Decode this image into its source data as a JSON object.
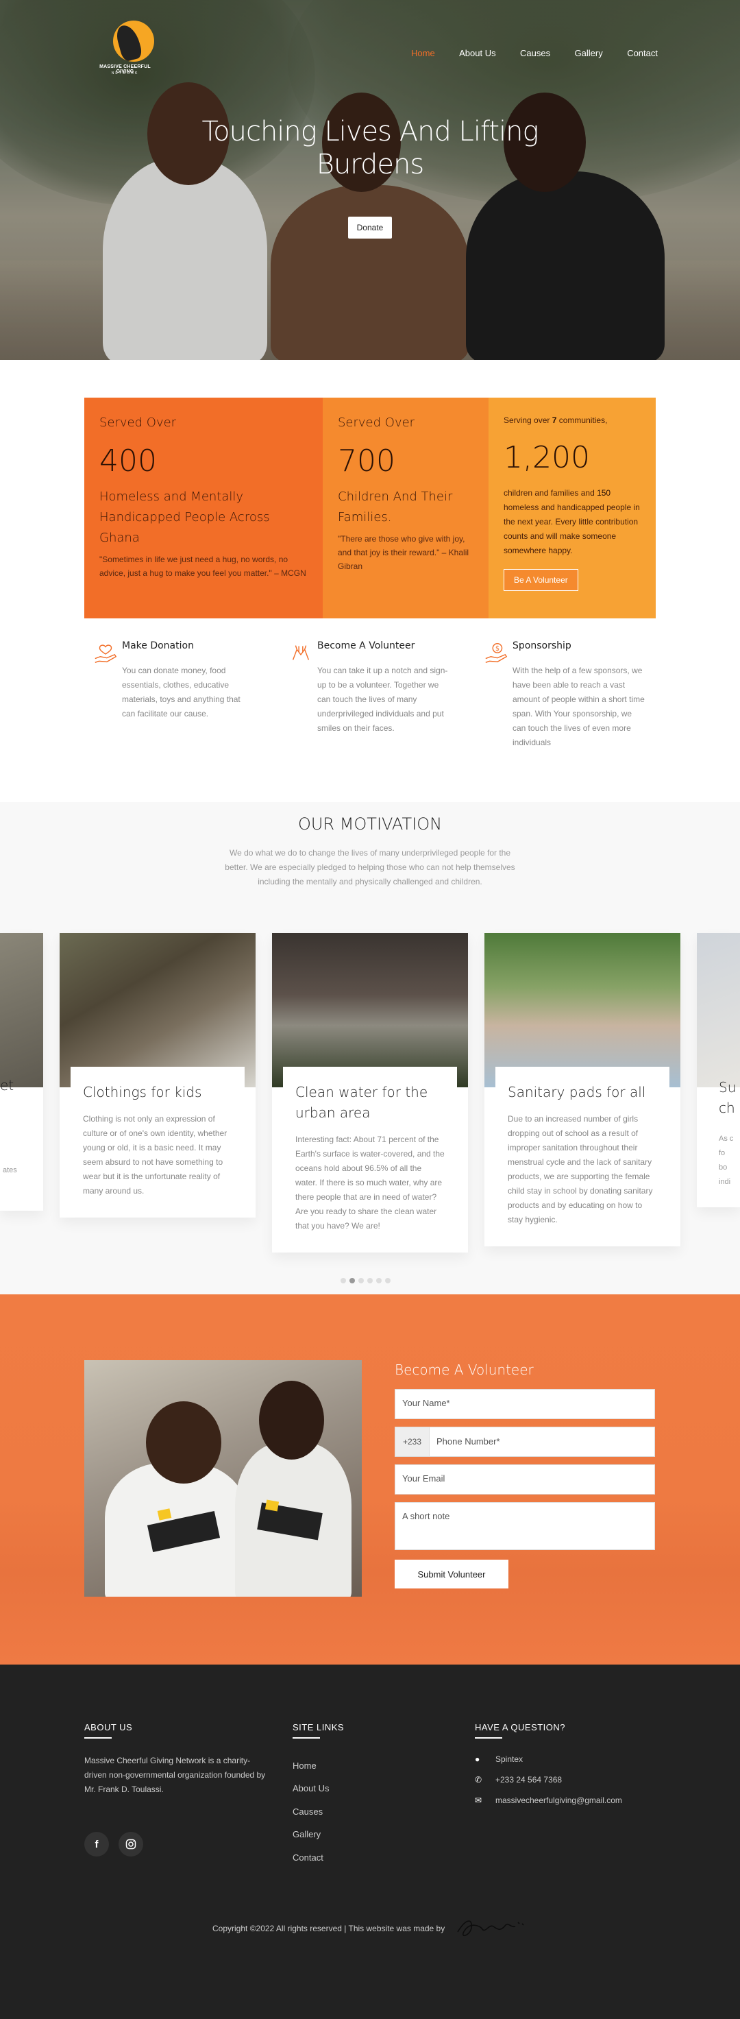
{
  "header": {
    "logo_text": "MASSIVE CHEERFUL GIVING",
    "logo_subtext": "NETWORK",
    "nav": [
      {
        "label": "Home",
        "active": true
      },
      {
        "label": "About Us",
        "active": false
      },
      {
        "label": "Causes",
        "active": false
      },
      {
        "label": "Gallery",
        "active": false
      },
      {
        "label": "Contact",
        "active": false
      }
    ]
  },
  "hero": {
    "title": "Touching Lives And Lifting Burdens",
    "button": "Donate"
  },
  "stats": [
    {
      "label": "Served Over",
      "number": "400",
      "desc": "Homeless and Mentally Handicapped People Across Ghana",
      "quote": "\"Sometimes in life we just need a hug, no words, no advice, just a hug to make you feel you matter.\" – MCGN"
    },
    {
      "label": "Served Over",
      "number": "700",
      "desc": "Children And Their Families.",
      "quote": "\"There are those who give with joy, and that joy is their reward.\" – Khalil Gibran"
    },
    {
      "label_pre": "Serving over ",
      "label_num": "7",
      "label_post": " communities,",
      "number": "1,200",
      "para_pre": "children and families and ",
      "para_num": "150",
      "para_post": " homeless and handicapped people in the next year. Every little contribution counts and will make someone somewhere happy.",
      "button": "Be A Volunteer"
    }
  ],
  "features": [
    {
      "icon": "hand-heart-icon",
      "title": "Make Donation",
      "text": "You can donate money, food essentials, clothes, educative materials, toys and anything that can facilitate our cause."
    },
    {
      "icon": "helping-hands-icon",
      "title": "Become A Volunteer",
      "text": "You can take it up a notch and sign-up to be a volunteer. Together we can touch the lives of many underprivileged individuals and put smiles on their faces."
    },
    {
      "icon": "hand-money-icon",
      "title": "Sponsorship",
      "text": "With the help of a few sponsors, we have been able to reach a vast amount of people within a short time span. With Your sponsorship, we can touch the lives of even more individuals"
    }
  ],
  "motivation": {
    "title": "OUR MOTIVATION",
    "lead": "We do what we do to change the lives of many underprivileged people for the better. We are especially pledged to helping those who can not help themselves including the mentally and physically challenged and children.",
    "cards": [
      {
        "title": "Clothings for kids",
        "text": "Clothing is not only an expression of culture or of one's own identity, whether young or old, it is a basic need. It may seem absurd to not have something to wear but it is the unfortunate reality of many around us."
      },
      {
        "title": "Clean water for the urban area",
        "text": "Interesting fact: About 71 percent of the Earth's surface is water-covered, and the oceans hold about 96.5% of all the water. If there is so much water, why are there people that are in need of water? Are you ready to share the clean water that you have? We are!"
      },
      {
        "title": "Sanitary pads for all",
        "text": "Due to an increased number of girls dropping out of school as a result of improper sanitation throughout their menstrual cycle and the lack of sanitary products, we are supporting the female child stay in school by donating sanitary products and by educating on how to stay hygienic."
      }
    ],
    "partial_left_title": "et",
    "partial_left_text": "ates",
    "partial_right_title": "Su ch",
    "partial_right_text": "As c fo bo indi",
    "dots": 6,
    "active_dot": 1
  },
  "volunteer": {
    "title": "Become A Volunteer",
    "name_placeholder": "Your Name*",
    "country_code": "+233",
    "phone_placeholder": "Phone Number*",
    "email_placeholder": "Your Email",
    "note_placeholder": "A short note",
    "submit": "Submit Volunteer"
  },
  "footer": {
    "about_heading": "ABOUT US",
    "about_text": "Massive Cheerful Giving Network is a charity-driven non-governmental organization founded by Mr. Frank D. Toulassi.",
    "social": [
      "facebook-icon",
      "instagram-icon"
    ],
    "links_heading": "SITE LINKS",
    "links": [
      "Home",
      "About Us",
      "Causes",
      "Gallery",
      "Contact"
    ],
    "contact_heading": "HAVE A QUESTION?",
    "address": "Spintex",
    "phone": "+233 24 564 7368",
    "email": "massivecheerfulgiving@gmail.com",
    "copyright": "Copyright ©2022 All rights reserved | This website was made by"
  },
  "colors": {
    "accent": "#f26e28",
    "stat2": "#f58a2e",
    "stat3": "#f7a234",
    "footer": "#222222",
    "volunteer_bg": "#ee7a42"
  }
}
